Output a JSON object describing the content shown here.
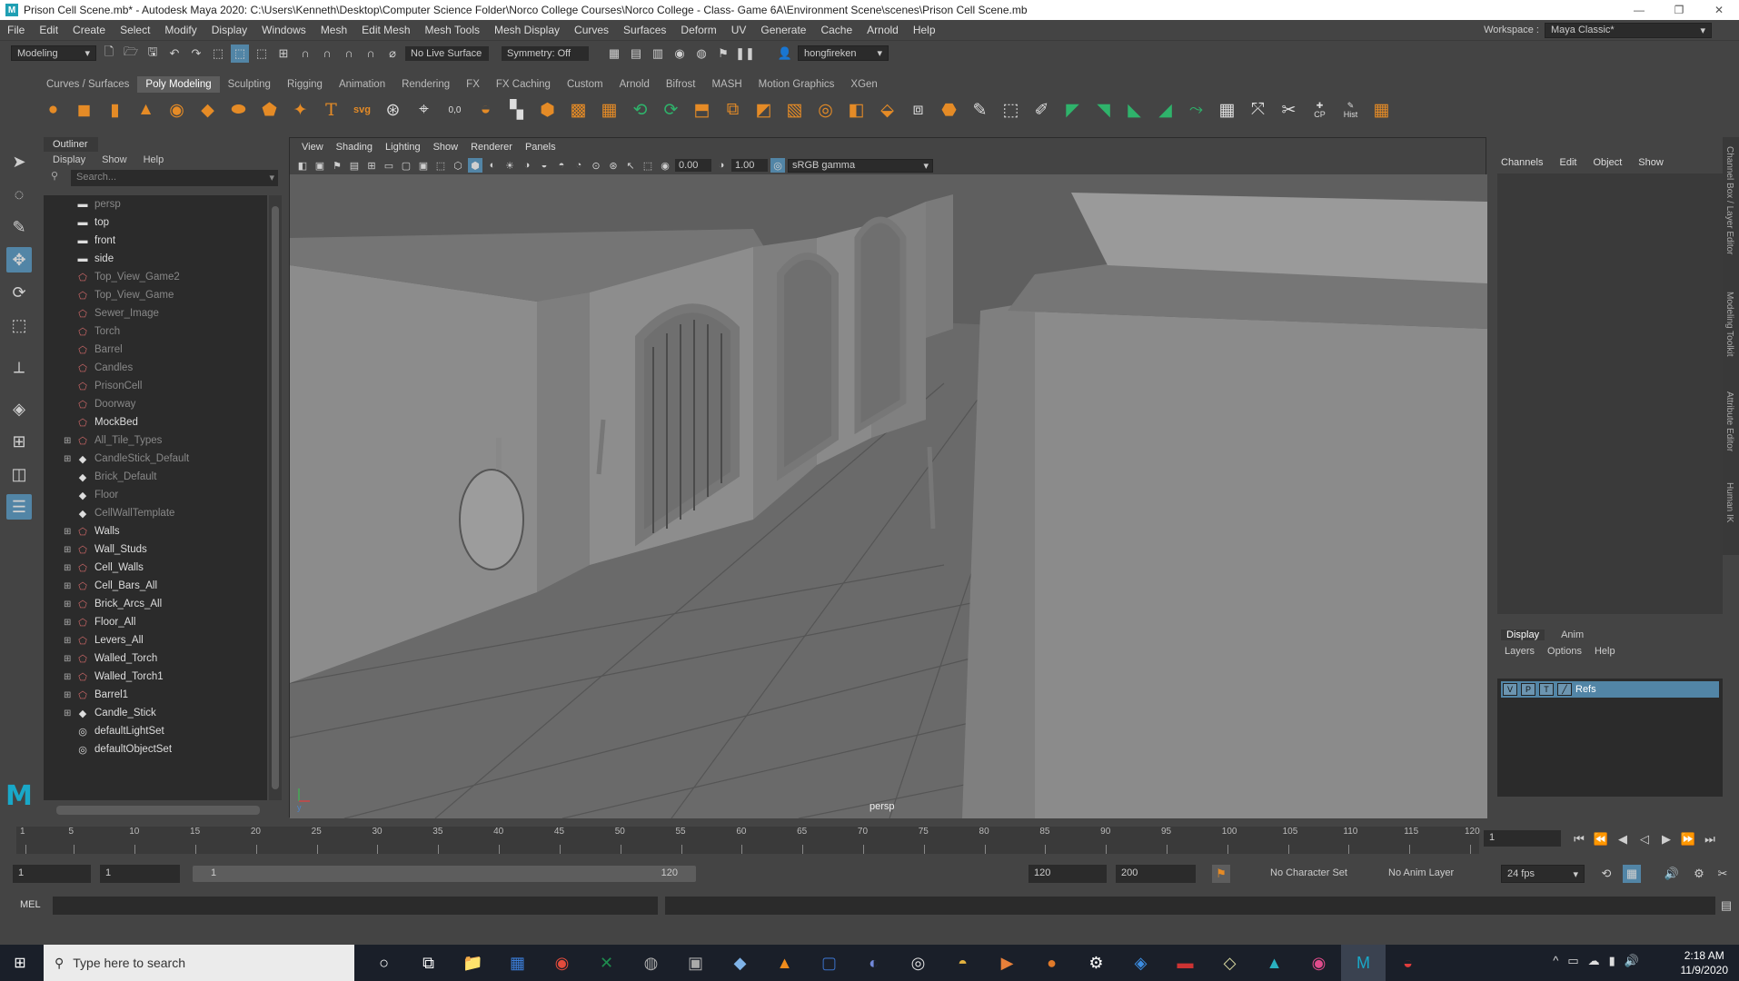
{
  "window": {
    "title": "Prison Cell Scene.mb* - Autodesk Maya 2020: C:\\Users\\Kenneth\\Desktop\\Computer Science Folder\\Norco College Courses\\Norco College - Class- Game 6A\\Environment Scene\\scenes\\Prison Cell Scene.mb"
  },
  "menubar": {
    "items": [
      "File",
      "Edit",
      "Create",
      "Select",
      "Modify",
      "Display",
      "Windows",
      "Mesh",
      "Edit Mesh",
      "Mesh Tools",
      "Mesh Display",
      "Curves",
      "Surfaces",
      "Deform",
      "UV",
      "Generate",
      "Cache",
      "Arnold",
      "Help"
    ],
    "workspace_label": "Workspace :",
    "workspace_value": "Maya Classic*"
  },
  "statusline": {
    "mode": "Modeling",
    "live_surface": "No Live Surface",
    "symmetry": "Symmetry: Off",
    "user": "hongfireken"
  },
  "shelf": {
    "tabs": [
      "Curves / Surfaces",
      "Poly Modeling",
      "Sculpting",
      "Rigging",
      "Animation",
      "Rendering",
      "FX",
      "FX Caching",
      "Custom",
      "Arnold",
      "Bifrost",
      "MASH",
      "Motion Graphics",
      "XGen"
    ],
    "active_tab": "Poly Modeling",
    "cp_label": "CP",
    "hist_label": "Hist"
  },
  "outliner": {
    "title": "Outliner",
    "menu": [
      "Display",
      "Show",
      "Help"
    ],
    "search_placeholder": "Search...",
    "items": [
      {
        "label": "persp",
        "icon": "camera-icon",
        "dim": true,
        "expand": false
      },
      {
        "label": "top",
        "icon": "camera-icon",
        "dim": false,
        "expand": false
      },
      {
        "label": "front",
        "icon": "camera-icon",
        "dim": false,
        "expand": false
      },
      {
        "label": "side",
        "icon": "camera-icon",
        "dim": false,
        "expand": false
      },
      {
        "label": "Top_View_Game2",
        "icon": "mesh-icon",
        "dim": true,
        "expand": false
      },
      {
        "label": "Top_View_Game",
        "icon": "mesh-icon",
        "dim": true,
        "expand": false
      },
      {
        "label": "Sewer_Image",
        "icon": "mesh-icon",
        "dim": true,
        "expand": false
      },
      {
        "label": "Torch",
        "icon": "mesh-icon",
        "dim": true,
        "expand": false
      },
      {
        "label": "Barrel",
        "icon": "mesh-icon",
        "dim": true,
        "expand": false
      },
      {
        "label": "Candles",
        "icon": "mesh-icon",
        "dim": true,
        "expand": false
      },
      {
        "label": "PrisonCell",
        "icon": "mesh-icon",
        "dim": true,
        "expand": false
      },
      {
        "label": "Doorway",
        "icon": "mesh-icon",
        "dim": true,
        "expand": false
      },
      {
        "label": "MockBed",
        "icon": "mesh-icon",
        "dim": false,
        "expand": false
      },
      {
        "label": "All_Tile_Types",
        "icon": "mesh-icon",
        "dim": true,
        "expand": true
      },
      {
        "label": "CandleStick_Default",
        "icon": "group-icon",
        "dim": true,
        "expand": true
      },
      {
        "label": "Brick_Default",
        "icon": "group-icon",
        "dim": true,
        "expand": false
      },
      {
        "label": "Floor",
        "icon": "group-icon",
        "dim": true,
        "expand": false
      },
      {
        "label": "CellWallTemplate",
        "icon": "group-icon",
        "dim": true,
        "expand": false
      },
      {
        "label": "Walls",
        "icon": "mesh-icon",
        "dim": false,
        "expand": true
      },
      {
        "label": "Wall_Studs",
        "icon": "mesh-icon",
        "dim": false,
        "expand": true
      },
      {
        "label": "Cell_Walls",
        "icon": "mesh-icon",
        "dim": false,
        "expand": true
      },
      {
        "label": "Cell_Bars_All",
        "icon": "mesh-icon",
        "dim": false,
        "expand": true
      },
      {
        "label": "Brick_Arcs_All",
        "icon": "mesh-icon",
        "dim": false,
        "expand": true
      },
      {
        "label": "Floor_All",
        "icon": "mesh-icon",
        "dim": false,
        "expand": true
      },
      {
        "label": "Levers_All",
        "icon": "mesh-icon",
        "dim": false,
        "expand": true
      },
      {
        "label": "Walled_Torch",
        "icon": "mesh-icon",
        "dim": false,
        "expand": true
      },
      {
        "label": "Walled_Torch1",
        "icon": "mesh-icon",
        "dim": false,
        "expand": true
      },
      {
        "label": "Barrel1",
        "icon": "mesh-icon",
        "dim": false,
        "expand": true
      },
      {
        "label": "Candle_Stick",
        "icon": "group-icon",
        "dim": false,
        "expand": true
      },
      {
        "label": "defaultLightSet",
        "icon": "set-icon",
        "dim": false,
        "expand": false
      },
      {
        "label": "defaultObjectSet",
        "icon": "set-icon",
        "dim": false,
        "expand": false
      }
    ]
  },
  "viewport": {
    "menu": [
      "View",
      "Shading",
      "Lighting",
      "Show",
      "Renderer",
      "Panels"
    ],
    "exposure": "0.00",
    "gamma": "1.00",
    "color_space": "sRGB gamma",
    "camera_label": "persp"
  },
  "channelbox": {
    "menu": [
      "Channels",
      "Edit",
      "Object",
      "Show"
    ],
    "side_tabs": [
      "Channel Box / Layer Editor",
      "Modeling Toolkit",
      "Attribute Editor",
      "Human IK"
    ]
  },
  "layers": {
    "tabs": [
      "Display",
      "Anim"
    ],
    "active_tab": "Display",
    "menu": [
      "Layers",
      "Options",
      "Help"
    ],
    "layer": {
      "v": "V",
      "p": "P",
      "t": "T",
      "name": "Refs"
    }
  },
  "timeline": {
    "ticks": [
      "1",
      "5",
      "10",
      "15",
      "20",
      "25",
      "30",
      "35",
      "40",
      "45",
      "50",
      "55",
      "60",
      "65",
      "70",
      "75",
      "80",
      "85",
      "90",
      "95",
      "100",
      "105",
      "110",
      "115",
      "120"
    ],
    "current_frame": "1"
  },
  "range": {
    "start": "1",
    "playback_start": "1",
    "slider_start": "1",
    "slider_end": "120",
    "playback_end": "120",
    "end": "200",
    "character_set": "No Character Set",
    "anim_layer": "No Anim Layer",
    "fps": "24 fps"
  },
  "cmdline": {
    "label": "MEL"
  },
  "taskbar": {
    "search_placeholder": "Type here to search",
    "time": "2:18 AM",
    "date": "11/9/2020"
  }
}
